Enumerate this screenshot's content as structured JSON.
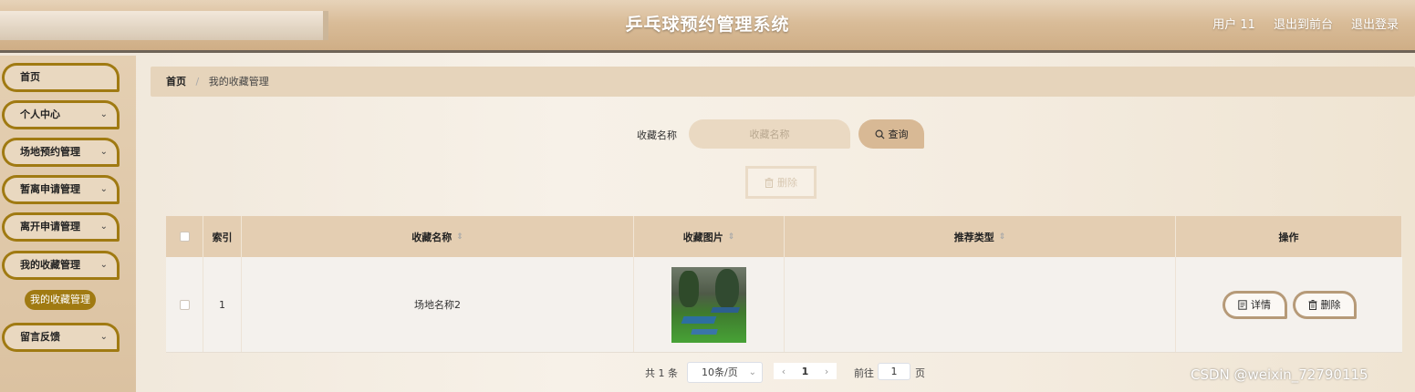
{
  "header": {
    "title": "乒乓球预约管理系统",
    "user": "用户 11",
    "to_front": "退出到前台",
    "logout": "退出登录"
  },
  "sidebar": {
    "items": [
      {
        "label": "首页"
      },
      {
        "label": "个人中心"
      },
      {
        "label": "场地预约管理"
      },
      {
        "label": "暂离申请管理"
      },
      {
        "label": "离开申请管理"
      },
      {
        "label": "我的收藏管理"
      },
      {
        "label": "留言反馈"
      }
    ],
    "sub_active": "我的收藏管理"
  },
  "breadcrumb": {
    "home": "首页",
    "separator": "/",
    "current": "我的收藏管理"
  },
  "search": {
    "label": "收藏名称",
    "placeholder": "收藏名称",
    "query_label": "查询"
  },
  "toolbar": {
    "delete_label": "删除"
  },
  "table": {
    "headers": [
      "索引",
      "收藏名称",
      "收藏图片",
      "推荐类型",
      "操作"
    ],
    "rows": [
      {
        "index": "1",
        "name": "场地名称2",
        "image": "ping-pong-court-photo",
        "type": "",
        "detail_label": "详情",
        "delete_label": "删除"
      }
    ]
  },
  "pagination": {
    "total": "共 1 条",
    "page_size": "10条/页",
    "current_page": "1",
    "goto_label": "前往",
    "goto_value": "1",
    "page_suffix": "页"
  },
  "watermark": "CSDN @weixin_72790115",
  "colors": {
    "accent": "#a07a12",
    "header": "#d9bc98",
    "table_header": "#e4ceb2"
  }
}
